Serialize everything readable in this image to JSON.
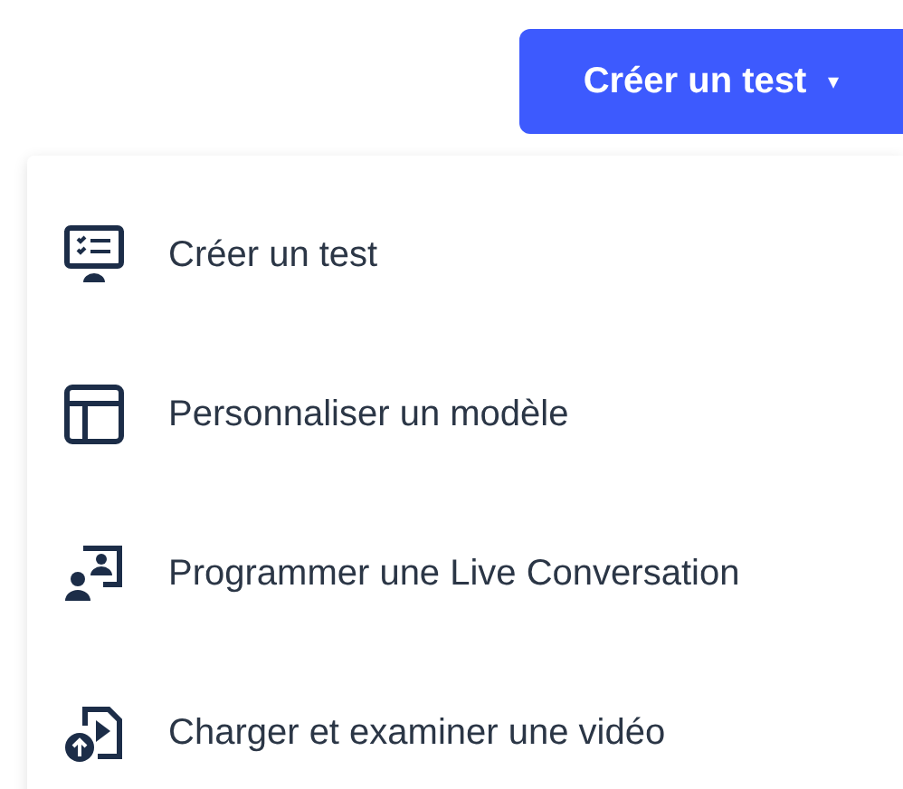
{
  "button": {
    "label": "Créer un test",
    "caret": "▾"
  },
  "menu": [
    {
      "kind": "test",
      "label": "Créer un test"
    },
    {
      "kind": "template",
      "label": "Personnaliser un modèle"
    },
    {
      "kind": "live",
      "label": "Programmer une Live Conversation"
    },
    {
      "kind": "upload",
      "label": "Charger et examiner une vidéo"
    }
  ]
}
